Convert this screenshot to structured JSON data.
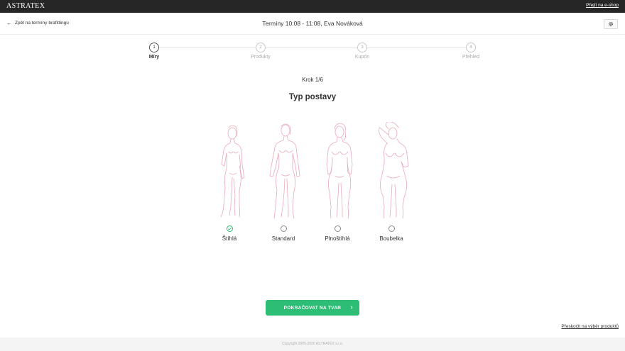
{
  "topbar": {
    "logo": "ASTRATEX",
    "eshop_link": "Přejít na e-shop"
  },
  "header": {
    "back_label": "Zpět na termíny brafittingu",
    "title": "Termíny 10:08 - 11:08, Eva Nováková",
    "settings_icon": "gear-icon"
  },
  "stepper": {
    "steps": [
      {
        "number": "1",
        "label": "Míry",
        "active": true
      },
      {
        "number": "2",
        "label": "Produkty",
        "active": false
      },
      {
        "number": "3",
        "label": "Kupón",
        "active": false
      },
      {
        "number": "4",
        "label": "Přehled",
        "active": false
      }
    ]
  },
  "main": {
    "step_indicator": "Krok 1/6",
    "title": "Typ postavy",
    "options": [
      {
        "label": "Štíhlá",
        "selected": true
      },
      {
        "label": "Standard",
        "selected": false
      },
      {
        "label": "Plnoštíhlá",
        "selected": false
      },
      {
        "label": "Boubelka",
        "selected": false
      }
    ],
    "continue_label": "POKRAČOVAT NA TVAR",
    "skip_label": "Přeskočit na výběr produktů"
  },
  "footer": {
    "copyright": "Copyright 2005-2020 ASTRATEX s.r.o."
  },
  "colors": {
    "topbar": "#262626",
    "accent": "#2ebd75",
    "figure_stroke": "#e8aab8"
  }
}
